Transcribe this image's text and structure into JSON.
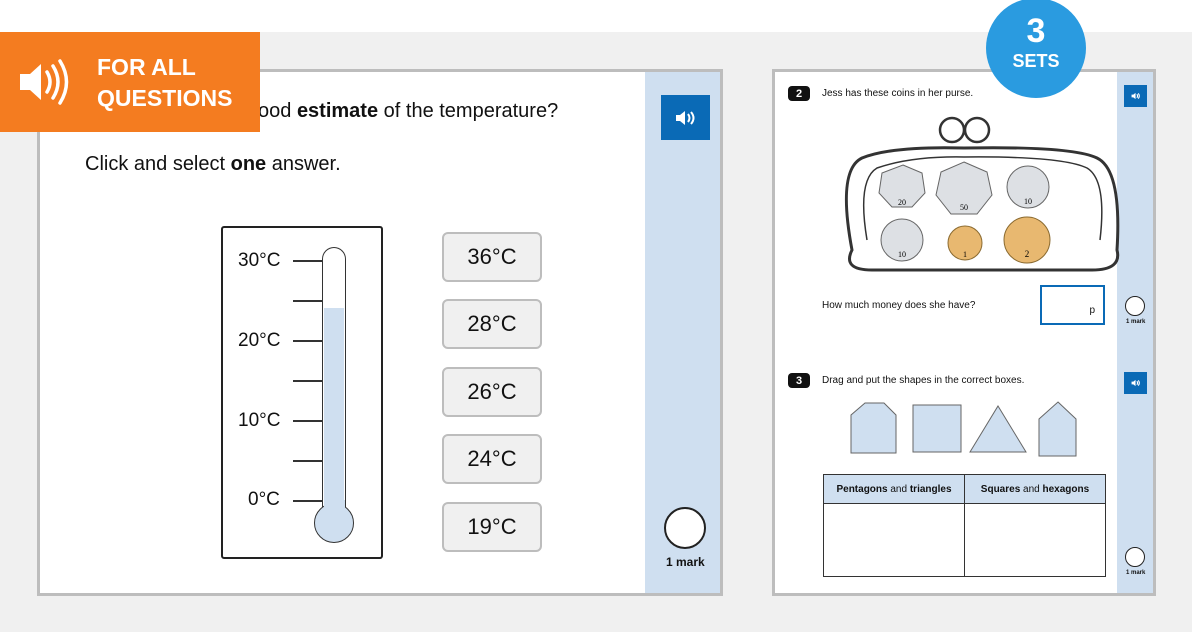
{
  "banner": {
    "line1": "FOR ALL",
    "line2": "QUESTIONS",
    "icon": "speaker-icon",
    "color": "#f47c20"
  },
  "badge": {
    "number": "3",
    "label": "SETS",
    "color": "#2a9be0"
  },
  "q1": {
    "question_pre": "ood ",
    "question_bold": "estimate",
    "question_post": " of the temperature?",
    "instruction_pre": "Click and select ",
    "instruction_bold": "one",
    "instruction_post": " answer.",
    "scale": [
      "30°C",
      "20°C",
      "10°C",
      "0°C"
    ],
    "thermometer_reading_c": 24,
    "answers": [
      "36°C",
      "28°C",
      "26°C",
      "24°C",
      "19°C"
    ],
    "mark": "1 mark"
  },
  "q2": {
    "number": "2",
    "text": "Jess has these coins in her purse.",
    "coins": [
      "20",
      "50",
      "10",
      "10",
      "1",
      "2"
    ],
    "prompt": "How much money does she have?",
    "unit": "p",
    "mark": "1 mark"
  },
  "q3": {
    "number": "3",
    "text": "Drag and put the shapes in the correct boxes.",
    "col1_b1": "Pentagons",
    "col1_m": " and ",
    "col1_b2": "triangles",
    "col2_b1": "Squares",
    "col2_m": " and ",
    "col2_b2": "hexagons",
    "mark": "1 mark"
  }
}
